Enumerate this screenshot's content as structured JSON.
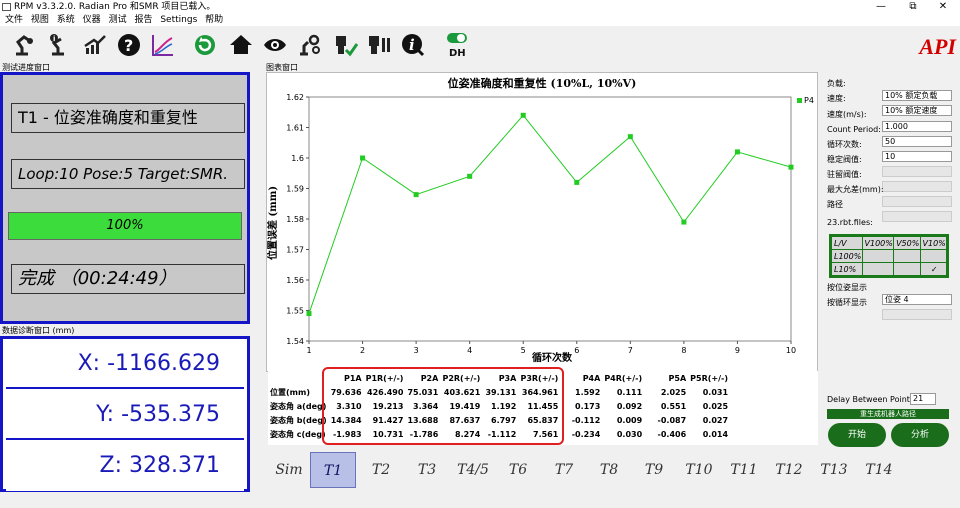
{
  "window": {
    "title": "RPM v3.3.2.0. Radian Pro 和SMR  项目已载入。",
    "controls": [
      "—",
      "⧉",
      "✕"
    ]
  },
  "menu": [
    "文件",
    "视图",
    "系统",
    "仪器",
    "测试",
    "报告",
    "Settings",
    "帮助"
  ],
  "toolbar": {
    "dh_label": "DH",
    "help_glyph": "?",
    "info_glyph": "i"
  },
  "logo": "API",
  "left": {
    "progress_panel_title": "测试进度窗口",
    "test_name": "T1 - 位姿准确度和重复性",
    "loop_text": "Loop:10 Pose:5  Target:SMR.",
    "progress_label": "100%",
    "progress_fraction": 1.0,
    "status_text": "完成 （00:24:49）",
    "diag_panel_title": "数据诊断窗口 (mm)",
    "x": "X: -1166.629",
    "y": "Y: -535.375",
    "z": "Z: 328.371"
  },
  "chart_panel_title": "图表窗口",
  "chart_data": {
    "type": "line",
    "title": "位姿准确度和重复性 (10%L, 10%V)",
    "xlabel": "循环次数",
    "ylabel": "位置误差 (mm)",
    "x": [
      1,
      2,
      3,
      4,
      5,
      6,
      7,
      8,
      9,
      10
    ],
    "series": [
      {
        "name": "P4",
        "values": [
          1.549,
          1.6,
          1.588,
          1.594,
          1.614,
          1.592,
          1.607,
          1.579,
          1.602,
          1.597
        ],
        "color": "#22cc22"
      }
    ],
    "xlim": [
      1,
      10
    ],
    "ylim": [
      1.54,
      1.62
    ],
    "yticks": [
      "1.54",
      "1.55",
      "1.56",
      "1.57",
      "1.58",
      "1.59",
      "1.6",
      "1.61",
      "1.62"
    ],
    "xticks": [
      "1",
      "2",
      "3",
      "4",
      "5",
      "6",
      "7",
      "8",
      "9",
      "10"
    ],
    "legend": "top-right",
    "grid": false
  },
  "table": {
    "headers": [
      "P1A",
      "P1R(+/-)",
      "P2A",
      "P2R(+/-)",
      "P3A",
      "P3R(+/-)",
      "P4A",
      "P4R(+/-)",
      "P5A",
      "P5R(+/-)"
    ],
    "rows": [
      {
        "label": "位置(mm)",
        "values": [
          "79.636",
          "426.490",
          "75.031",
          "403.621",
          "39.131",
          "364.961",
          "1.592",
          "0.111",
          "2.025",
          "0.031"
        ]
      },
      {
        "label": "姿态角 a(deg)",
        "values": [
          "3.310",
          "19.213",
          "3.364",
          "19.419",
          "1.192",
          "11.455",
          "0.173",
          "0.092",
          "0.551",
          "0.025"
        ]
      },
      {
        "label": "姿态角 b(deg)",
        "values": [
          "14.384",
          "91.427",
          "13.688",
          "87.637",
          "6.797",
          "65.837",
          "-0.112",
          "0.009",
          "-0.087",
          "0.027"
        ]
      },
      {
        "label": "姿态角 c(deg)",
        "values": [
          "-1.983",
          "10.731",
          "-1.786",
          "8.274",
          "-1.112",
          "7.561",
          "-0.234",
          "0.030",
          "-0.406",
          "0.014"
        ]
      }
    ]
  },
  "right": {
    "load_label": "负载:",
    "load_value": "10% 额定负载",
    "speed_label": "速度:",
    "speed_value": "10% 额定速度",
    "speed_ms_label": "速度(m/s):",
    "speed_ms_value": "1.000",
    "count_period_label": "Count Period:",
    "count_period_value": "50",
    "cycles_label": "循环次数:",
    "cycles_value": "10",
    "stable_label": "稳定阀值:",
    "dwell_label": "驻留阀值:",
    "max_dev_label": "最大允差(mm):",
    "path_label": "路径",
    "files_label": "23.rbt.files:",
    "grid": {
      "header": [
        "L/V",
        "V100%",
        "V50%",
        "V10%"
      ],
      "rows": [
        [
          "L100%",
          "",
          "",
          ""
        ],
        [
          "L10%",
          "",
          "",
          "✓"
        ]
      ]
    },
    "show_pose_label": "按位姿显示",
    "show_pose_value": "位姿 4",
    "show_cycle_label": "按循环显示",
    "delay_label": "Delay Between Point",
    "delay_value": "21",
    "regen_label": "重生成机器人路径",
    "start_label": "开始",
    "analyze_label": "分析"
  },
  "tabs": [
    "Sim",
    "T1",
    "T2",
    "T3",
    "T4/5",
    "T6",
    "T7",
    "T8",
    "T9",
    "T10",
    "T11",
    "T12",
    "T13",
    "T14"
  ],
  "active_tab": "T1"
}
